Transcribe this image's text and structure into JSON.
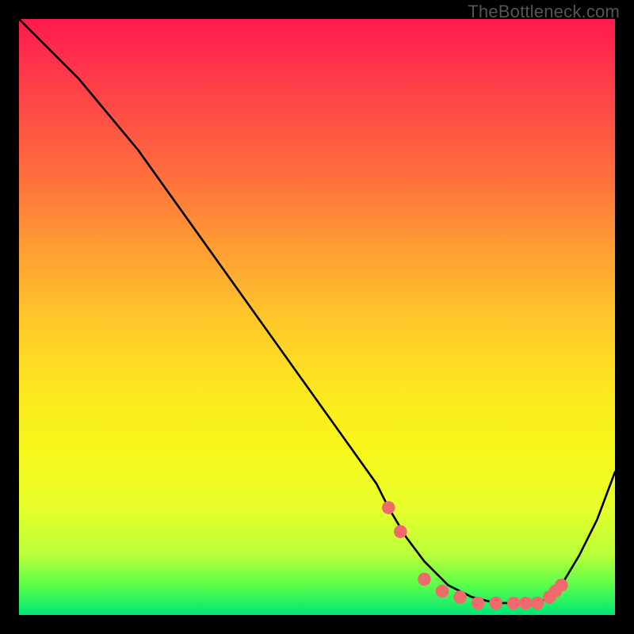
{
  "watermark": "TheBottleneck.com",
  "chart_data": {
    "type": "line",
    "title": "",
    "xlabel": "",
    "ylabel": "",
    "x_range": [
      0,
      100
    ],
    "y_range": [
      0,
      100
    ],
    "series": [
      {
        "name": "curve",
        "x": [
          0,
          5,
          10,
          15,
          20,
          25,
          30,
          35,
          40,
          45,
          50,
          55,
          60,
          62,
          65,
          68,
          72,
          76,
          80,
          84,
          87,
          89,
          91,
          94,
          97,
          100
        ],
        "y": [
          100,
          95,
          90,
          84,
          78,
          71,
          64,
          57,
          50,
          43,
          36,
          29,
          22,
          18,
          13,
          9,
          5,
          3,
          2,
          2,
          2,
          3,
          5,
          10,
          16,
          24
        ]
      }
    ],
    "markers": {
      "name": "highlight-dots",
      "color": "#ef6b6b",
      "x": [
        62,
        64,
        68,
        71,
        74,
        77,
        80,
        83,
        85,
        87,
        89,
        90,
        91
      ],
      "y": [
        18,
        14,
        6,
        4,
        3,
        2,
        2,
        2,
        2,
        2,
        3,
        4,
        5
      ]
    }
  }
}
